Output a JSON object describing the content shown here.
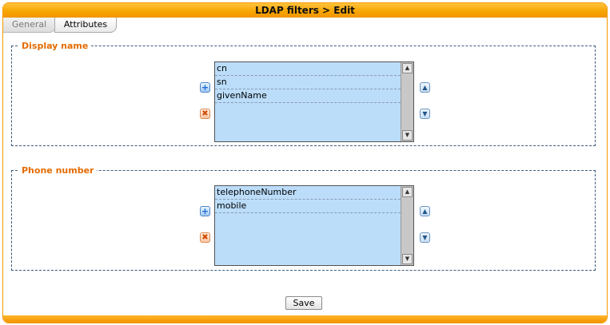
{
  "window": {
    "title": "LDAP filters > Edit"
  },
  "tabs": [
    {
      "label": "General",
      "active": false
    },
    {
      "label": "Attributes",
      "active": true
    }
  ],
  "groups": {
    "display_name": {
      "legend": "Display name",
      "items": [
        "cn",
        "sn",
        "givenName"
      ]
    },
    "phone_number": {
      "legend": "Phone number",
      "items": [
        "telephoneNumber",
        "mobile"
      ]
    }
  },
  "icons": {
    "add": "+",
    "remove": "✖",
    "move_up": "▲",
    "move_down": "▼",
    "scroll_up": "▲",
    "scroll_down": "▼"
  },
  "footer": {
    "save_label": "Save"
  },
  "colors": {
    "accent": "#f7a400",
    "legend": "#e46b00",
    "list_bg": "#bbddfa",
    "border_dash": "#3b5a7d"
  }
}
